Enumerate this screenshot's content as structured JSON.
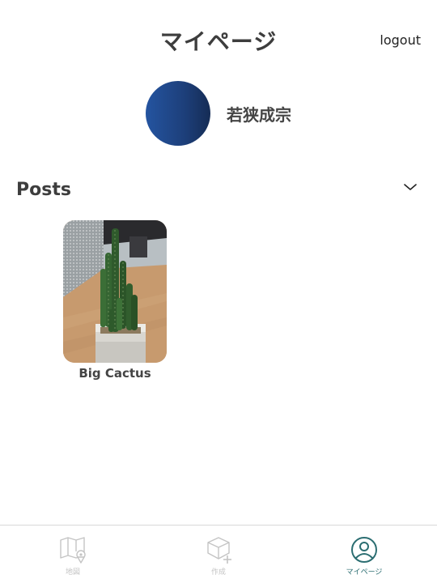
{
  "header": {
    "title": "マイページ",
    "logout_label": "logout"
  },
  "profile": {
    "username": "若狭成宗"
  },
  "posts": {
    "section_title": "Posts",
    "items": [
      {
        "title": "Big Cactus"
      }
    ]
  },
  "bottom_nav": {
    "items": [
      {
        "label": "地図",
        "icon": "map-pin-icon",
        "active": false
      },
      {
        "label": "作成",
        "icon": "box-plus-icon",
        "active": false
      },
      {
        "label": "マイページ",
        "icon": "user-circle-icon",
        "active": true
      }
    ]
  },
  "colors": {
    "active": "#2c6e72",
    "inactive": "#c4c4c4",
    "avatar": "#2454a0"
  }
}
